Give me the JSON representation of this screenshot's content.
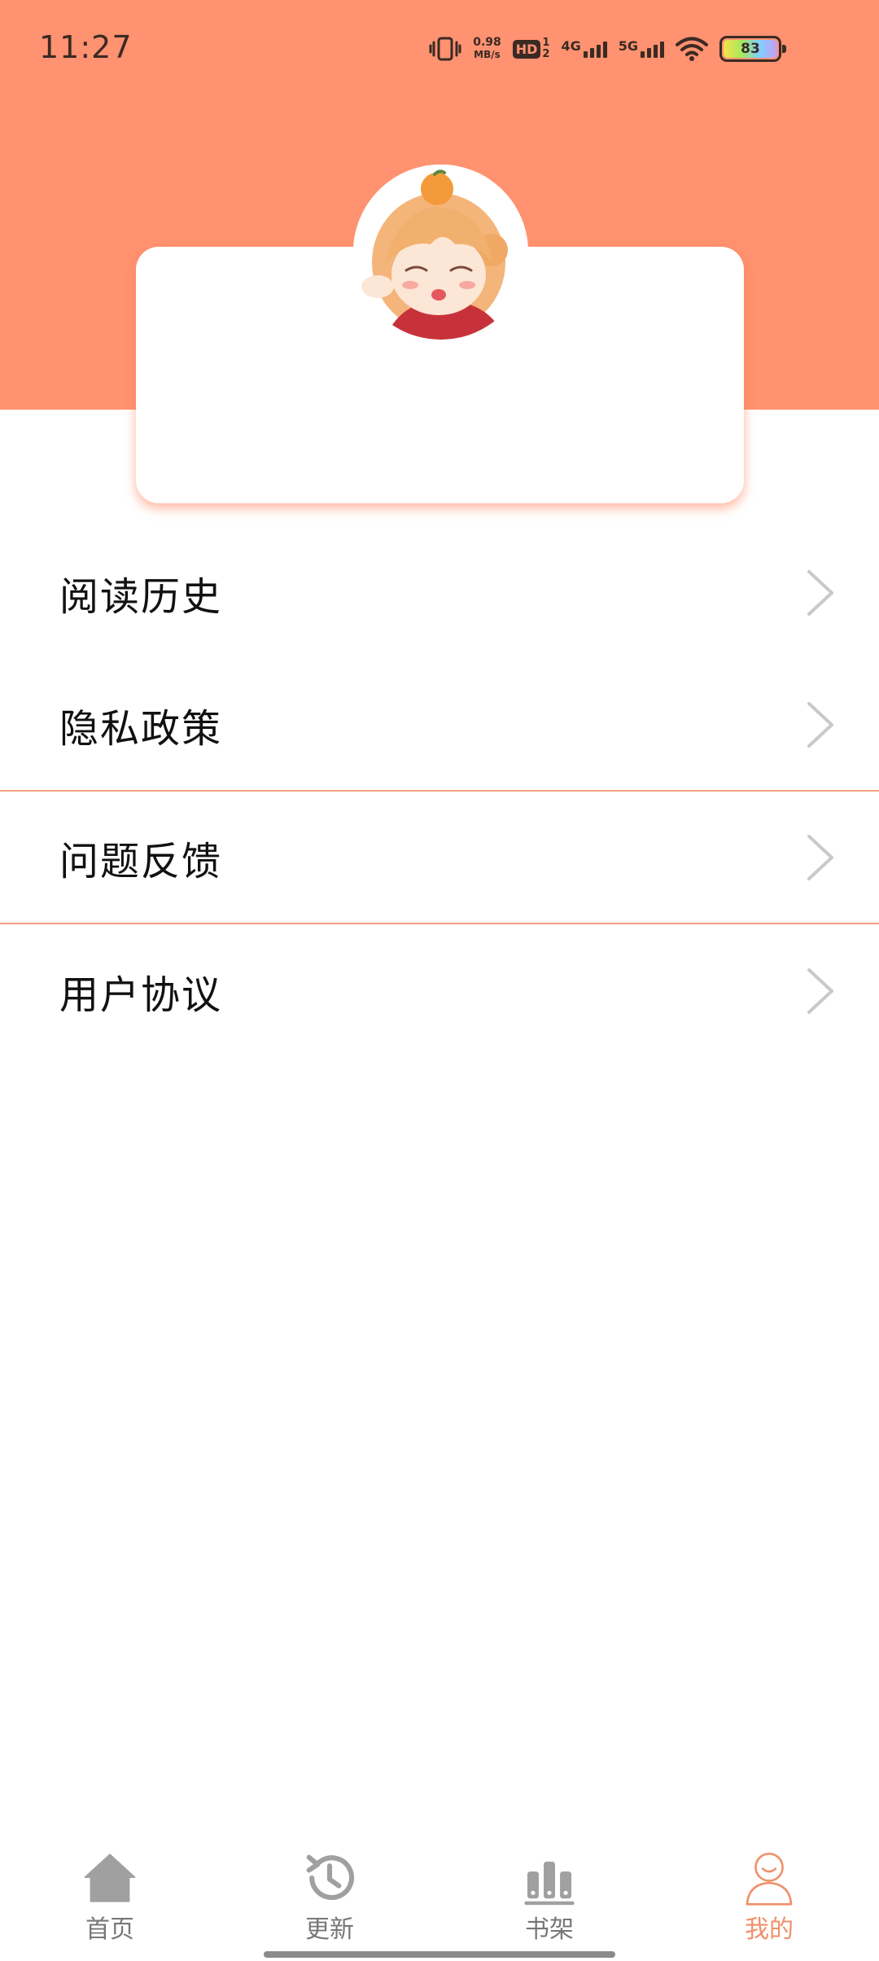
{
  "status_bar": {
    "time": "11:27",
    "net_speed_value": "0.98",
    "net_speed_unit": "MB/s",
    "hd_label": "HD",
    "hd_sim_top": "1",
    "hd_sim_bottom": "2",
    "network_1": "4G",
    "network_2": "5G",
    "battery_level": "83",
    "icons": [
      "vibrate-icon",
      "wifi-icon",
      "battery-icon"
    ]
  },
  "theme": {
    "accent": "#FF9270",
    "active_nav": "#F0906A",
    "inactive_nav": "#A0A0A0"
  },
  "menu": {
    "items": [
      {
        "label": "阅读历史",
        "icon": "chevron-right-icon"
      },
      {
        "label": "隐私政策",
        "icon": "chevron-right-icon"
      },
      {
        "label": "问题反馈",
        "icon": "chevron-right-icon"
      },
      {
        "label": "用户协议",
        "icon": "chevron-right-icon"
      }
    ]
  },
  "bottom_nav": {
    "items": [
      {
        "label": "首页",
        "icon": "home-icon",
        "active": false
      },
      {
        "label": "更新",
        "icon": "history-icon",
        "active": false
      },
      {
        "label": "书架",
        "icon": "bookshelf-icon",
        "active": false
      },
      {
        "label": "我的",
        "icon": "profile-icon",
        "active": true
      }
    ]
  }
}
